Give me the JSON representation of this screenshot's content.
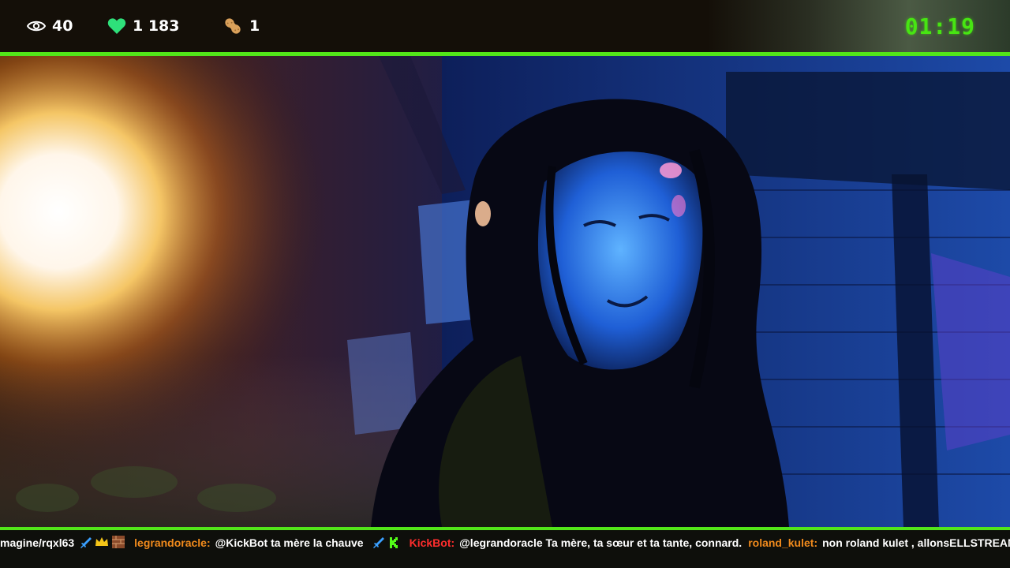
{
  "hud": {
    "viewers": "40",
    "likes": "1 183",
    "peanuts": "1",
    "timer": "01:19",
    "accent_color": "#52e619",
    "icons": [
      "eye-icon",
      "heart-icon",
      "peanut-icon"
    ]
  },
  "chat": {
    "messages": [
      {
        "user": "",
        "text": "magine/rqxl63",
        "badges": [
          "sword-icon",
          "crown-icon",
          "brick-badge-icon"
        ]
      },
      {
        "user": "legrandoracle:",
        "user_color": "#f08a1c",
        "text": "@KickBot ta mère la chauve",
        "badges": [
          "sword-icon",
          "kick-badge-icon"
        ]
      },
      {
        "user": "KickBot:",
        "user_color": "#ff2d2d",
        "text": "@legrandoracle Ta mère, ta sœur et ta tante, connard."
      },
      {
        "user": "roland_kulet:",
        "user_color": "#f08a1c",
        "text": "non roland kulet , allonsELLSTREAM"
      }
    ]
  }
}
